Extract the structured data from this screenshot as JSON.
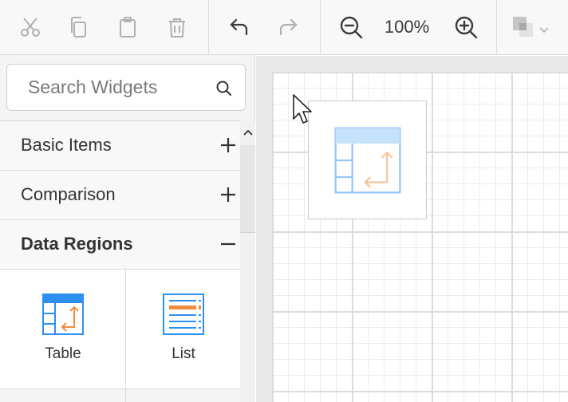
{
  "toolbar": {
    "zoom_level": "100%",
    "buttons": {
      "cut": "scissors-icon",
      "copy": "copy-icon",
      "paste": "clipboard-icon",
      "delete": "trash-icon",
      "undo": "undo-icon",
      "redo": "redo-icon",
      "zoom_out": "zoom-out-icon",
      "zoom_in": "zoom-in-icon",
      "order": "layer-order-icon"
    }
  },
  "sidebar": {
    "search": {
      "placeholder": "Search Widgets",
      "value": ""
    },
    "sections": [
      {
        "label": "Basic Items",
        "expanded": false
      },
      {
        "label": "Comparison",
        "expanded": false
      },
      {
        "label": "Data Regions",
        "expanded": true
      }
    ],
    "items": [
      {
        "label": "Table",
        "icon": "table-icon"
      },
      {
        "label": "List",
        "icon": "list-icon"
      }
    ]
  },
  "canvas": {
    "dragged_item_icon": "table-icon"
  },
  "colors": {
    "accent_blue": "#2d8ff0",
    "accent_orange": "#f08c3c",
    "icon_gray": "#b0b0b0",
    "icon_dark": "#3a3a3a"
  }
}
